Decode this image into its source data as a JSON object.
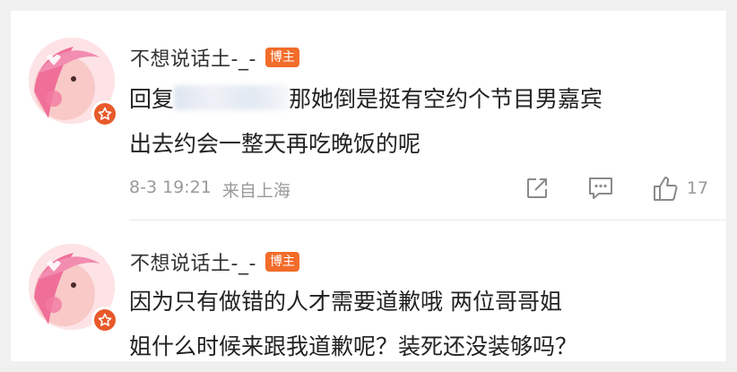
{
  "comments": [
    {
      "username": "不想说话土-_-",
      "tag": "博主",
      "reply_prefix": "回复",
      "text_line1": "那她倒是挺有空约个节目男嘉宾",
      "text_line2": "出去约会一整天再吃晚饭的呢",
      "date": "8-3 19:21",
      "location": "来自上海",
      "likes": "17"
    },
    {
      "username": "不想说话土-_-",
      "tag": "博主",
      "text_line1": "因为只有做错的人才需要道歉哦 两位哥哥姐",
      "text_line2": "姐什么时候来跟我道歉呢？装死还没装够吗？"
    }
  ],
  "icons": {
    "share": "share-icon",
    "comment": "comment-icon",
    "like": "thumbs-up-icon",
    "badge": "star-badge-icon"
  },
  "colors": {
    "tag_bg": "#f26c2a",
    "badge_bg": "#e85a2a",
    "avatar_bg": "#fde0e3",
    "meta": "#9a9a9a"
  }
}
